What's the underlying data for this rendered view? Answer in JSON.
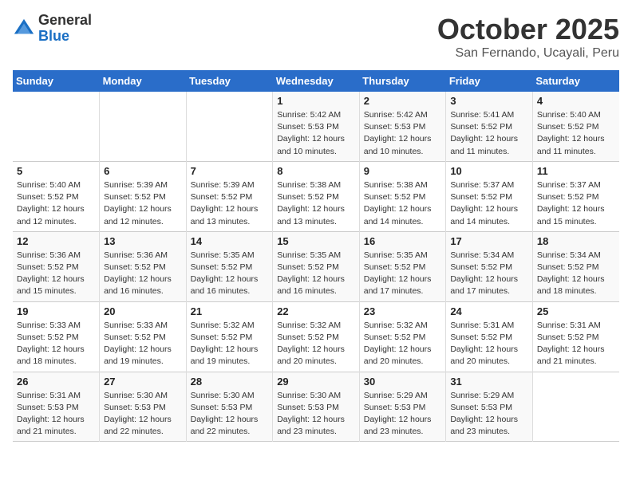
{
  "header": {
    "logo_general": "General",
    "logo_blue": "Blue",
    "month_title": "October 2025",
    "location": "San Fernando, Ucayali, Peru"
  },
  "calendar": {
    "days_of_week": [
      "Sunday",
      "Monday",
      "Tuesday",
      "Wednesday",
      "Thursday",
      "Friday",
      "Saturday"
    ],
    "weeks": [
      [
        {
          "day": "",
          "info": ""
        },
        {
          "day": "",
          "info": ""
        },
        {
          "day": "",
          "info": ""
        },
        {
          "day": "1",
          "info": "Sunrise: 5:42 AM\nSunset: 5:53 PM\nDaylight: 12 hours\nand 10 minutes."
        },
        {
          "day": "2",
          "info": "Sunrise: 5:42 AM\nSunset: 5:53 PM\nDaylight: 12 hours\nand 10 minutes."
        },
        {
          "day": "3",
          "info": "Sunrise: 5:41 AM\nSunset: 5:52 PM\nDaylight: 12 hours\nand 11 minutes."
        },
        {
          "day": "4",
          "info": "Sunrise: 5:40 AM\nSunset: 5:52 PM\nDaylight: 12 hours\nand 11 minutes."
        }
      ],
      [
        {
          "day": "5",
          "info": "Sunrise: 5:40 AM\nSunset: 5:52 PM\nDaylight: 12 hours\nand 12 minutes."
        },
        {
          "day": "6",
          "info": "Sunrise: 5:39 AM\nSunset: 5:52 PM\nDaylight: 12 hours\nand 12 minutes."
        },
        {
          "day": "7",
          "info": "Sunrise: 5:39 AM\nSunset: 5:52 PM\nDaylight: 12 hours\nand 13 minutes."
        },
        {
          "day": "8",
          "info": "Sunrise: 5:38 AM\nSunset: 5:52 PM\nDaylight: 12 hours\nand 13 minutes."
        },
        {
          "day": "9",
          "info": "Sunrise: 5:38 AM\nSunset: 5:52 PM\nDaylight: 12 hours\nand 14 minutes."
        },
        {
          "day": "10",
          "info": "Sunrise: 5:37 AM\nSunset: 5:52 PM\nDaylight: 12 hours\nand 14 minutes."
        },
        {
          "day": "11",
          "info": "Sunrise: 5:37 AM\nSunset: 5:52 PM\nDaylight: 12 hours\nand 15 minutes."
        }
      ],
      [
        {
          "day": "12",
          "info": "Sunrise: 5:36 AM\nSunset: 5:52 PM\nDaylight: 12 hours\nand 15 minutes."
        },
        {
          "day": "13",
          "info": "Sunrise: 5:36 AM\nSunset: 5:52 PM\nDaylight: 12 hours\nand 16 minutes."
        },
        {
          "day": "14",
          "info": "Sunrise: 5:35 AM\nSunset: 5:52 PM\nDaylight: 12 hours\nand 16 minutes."
        },
        {
          "day": "15",
          "info": "Sunrise: 5:35 AM\nSunset: 5:52 PM\nDaylight: 12 hours\nand 16 minutes."
        },
        {
          "day": "16",
          "info": "Sunrise: 5:35 AM\nSunset: 5:52 PM\nDaylight: 12 hours\nand 17 minutes."
        },
        {
          "day": "17",
          "info": "Sunrise: 5:34 AM\nSunset: 5:52 PM\nDaylight: 12 hours\nand 17 minutes."
        },
        {
          "day": "18",
          "info": "Sunrise: 5:34 AM\nSunset: 5:52 PM\nDaylight: 12 hours\nand 18 minutes."
        }
      ],
      [
        {
          "day": "19",
          "info": "Sunrise: 5:33 AM\nSunset: 5:52 PM\nDaylight: 12 hours\nand 18 minutes."
        },
        {
          "day": "20",
          "info": "Sunrise: 5:33 AM\nSunset: 5:52 PM\nDaylight: 12 hours\nand 19 minutes."
        },
        {
          "day": "21",
          "info": "Sunrise: 5:32 AM\nSunset: 5:52 PM\nDaylight: 12 hours\nand 19 minutes."
        },
        {
          "day": "22",
          "info": "Sunrise: 5:32 AM\nSunset: 5:52 PM\nDaylight: 12 hours\nand 20 minutes."
        },
        {
          "day": "23",
          "info": "Sunrise: 5:32 AM\nSunset: 5:52 PM\nDaylight: 12 hours\nand 20 minutes."
        },
        {
          "day": "24",
          "info": "Sunrise: 5:31 AM\nSunset: 5:52 PM\nDaylight: 12 hours\nand 20 minutes."
        },
        {
          "day": "25",
          "info": "Sunrise: 5:31 AM\nSunset: 5:52 PM\nDaylight: 12 hours\nand 21 minutes."
        }
      ],
      [
        {
          "day": "26",
          "info": "Sunrise: 5:31 AM\nSunset: 5:53 PM\nDaylight: 12 hours\nand 21 minutes."
        },
        {
          "day": "27",
          "info": "Sunrise: 5:30 AM\nSunset: 5:53 PM\nDaylight: 12 hours\nand 22 minutes."
        },
        {
          "day": "28",
          "info": "Sunrise: 5:30 AM\nSunset: 5:53 PM\nDaylight: 12 hours\nand 22 minutes."
        },
        {
          "day": "29",
          "info": "Sunrise: 5:30 AM\nSunset: 5:53 PM\nDaylight: 12 hours\nand 23 minutes."
        },
        {
          "day": "30",
          "info": "Sunrise: 5:29 AM\nSunset: 5:53 PM\nDaylight: 12 hours\nand 23 minutes."
        },
        {
          "day": "31",
          "info": "Sunrise: 5:29 AM\nSunset: 5:53 PM\nDaylight: 12 hours\nand 23 minutes."
        },
        {
          "day": "",
          "info": ""
        }
      ]
    ]
  }
}
